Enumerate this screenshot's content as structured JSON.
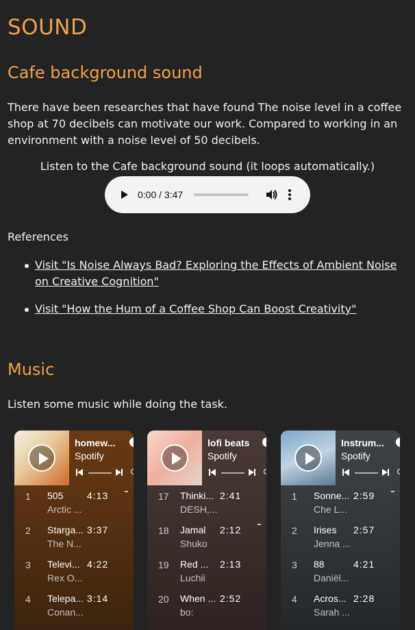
{
  "page": {
    "title": "SOUND",
    "cafe": {
      "heading": "Cafe background sound",
      "description": "There have been researches that have found The noise level in a coffee shop at 70 decibels can motivate our work. Compared to working in an environment with a noise level of 50 decibels.",
      "listen_text": "Listen to the Cafe background sound (it loops automatically.)",
      "player": {
        "time": "0:00 / 3:47"
      }
    },
    "references": {
      "label": "References",
      "links": [
        "Visit \"Is Noise Always Bad? Exploring the Effects of Ambient Noise on Creative Cognition\"",
        "Visit \"How the Hum of a Coffee Shop Can Boost Creativity\""
      ]
    },
    "music": {
      "heading": "Music",
      "intro": "Listen some music while doing the task."
    }
  },
  "embeds": [
    {
      "title": "homew...",
      "subtitle": "Spotify",
      "colors": {
        "top": "#6b3a12",
        "bottom": "#3c2410"
      },
      "tracks": [
        {
          "num": "1",
          "name": "505",
          "artist": "Arctic ...",
          "dur": "4:13"
        },
        {
          "num": "2",
          "name": "Starga...",
          "artist": "The N...",
          "dur": "3:37"
        },
        {
          "num": "3",
          "name": "Televi...",
          "artist": "Rex O...",
          "dur": "4:22"
        },
        {
          "num": "4",
          "name": "Telepa...",
          "artist": "Conan...",
          "dur": "3:14"
        }
      ]
    },
    {
      "title": "lofi beats",
      "subtitle": "Spotify",
      "colors": {
        "top": "#4a3a36",
        "bottom": "#2e2321"
      },
      "tracks": [
        {
          "num": "17",
          "name": "Thinki...",
          "artist": "DESH,...",
          "dur": "2:41"
        },
        {
          "num": "18",
          "name": "Jamal",
          "artist": "Shuko",
          "dur": "2:12"
        },
        {
          "num": "19",
          "name": "Red ...",
          "artist": "Luchii",
          "dur": "2:13"
        },
        {
          "num": "20",
          "name": "When ...",
          "artist": "bo:",
          "dur": "2:52"
        }
      ]
    },
    {
      "title": "Instrum...",
      "subtitle": "Spotify",
      "colors": {
        "top": "#3f4447",
        "bottom": "#24282b"
      },
      "tracks": [
        {
          "num": "1",
          "name": "Sonne...",
          "artist": "Che L...",
          "dur": "2:59"
        },
        {
          "num": "2",
          "name": "Irises",
          "artist": "Jenna ...",
          "dur": "2:57"
        },
        {
          "num": "3",
          "name": "88",
          "artist": "Daniël...",
          "dur": "4:21"
        },
        {
          "num": "4",
          "name": "Acros...",
          "artist": "Sarah ...",
          "dur": "2:28"
        }
      ]
    }
  ]
}
